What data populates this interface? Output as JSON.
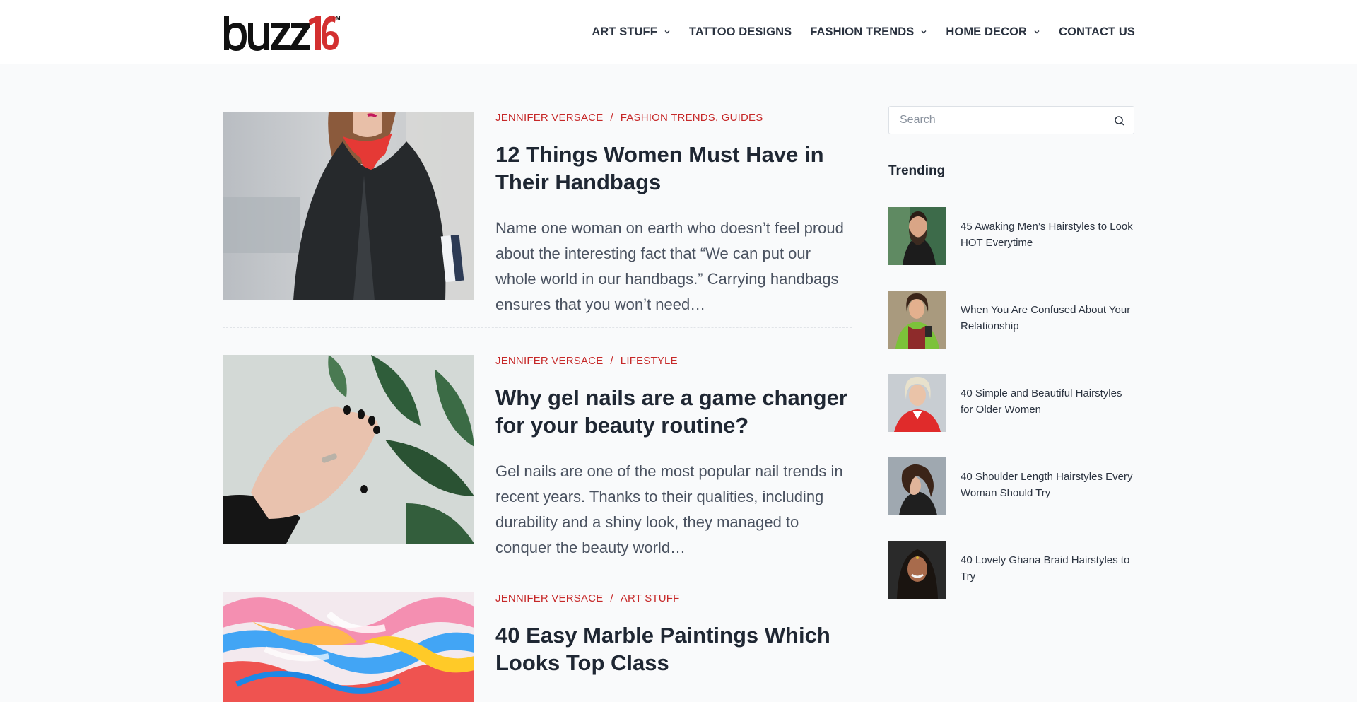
{
  "header": {
    "logo_text": "buzz16",
    "logo_tm": "TM",
    "nav": [
      {
        "label": "ART STUFF",
        "has_dropdown": true
      },
      {
        "label": "TATTOO DESIGNS",
        "has_dropdown": false
      },
      {
        "label": "FASHION TRENDS",
        "has_dropdown": true
      },
      {
        "label": "HOME DECOR",
        "has_dropdown": true
      },
      {
        "label": "CONTACT US",
        "has_dropdown": false
      }
    ]
  },
  "posts": [
    {
      "author": "JENNIFER VERSACE",
      "separator": "/",
      "categories": "FASHION TRENDS, GUIDES",
      "title": "12 Things Women Must Have in Their Handbags",
      "excerpt": "Name one woman on earth who doesn’t feel proud about the interesting fact that “We can put our whole world in our handbags.” Carrying handbags ensures that you won’t need…",
      "image_icon": "woman-blazer-red-scarf-image"
    },
    {
      "author": "JENNIFER VERSACE",
      "separator": "/",
      "categories": "LIFESTYLE",
      "title": "Why gel nails are a game changer for your beauty routine?",
      "excerpt": "Gel nails are one of the most popular nail trends in recent years. Thanks to their qualities, including durability and a shiny look, they managed to conquer the beauty world…",
      "image_icon": "hand-black-nails-leaves-image"
    },
    {
      "author": "JENNIFER VERSACE",
      "separator": "/",
      "categories": "ART STUFF",
      "title": "40 Easy Marble Paintings Which Looks Top Class",
      "excerpt": "",
      "image_icon": "marble-paint-image"
    }
  ],
  "sidebar": {
    "search_placeholder": "Search",
    "trending_title": "Trending",
    "trending": [
      {
        "title": "45 Awaking Men’s Hairstyles to Look HOT Everytime",
        "thumb_icon": "bearded-man-thumbnail"
      },
      {
        "title": "When You Are Confused About Your Relationship",
        "thumb_icon": "woman-green-jacket-thumbnail"
      },
      {
        "title": "40 Simple and Beautiful Hairstyles for Older Women",
        "thumb_icon": "blonde-woman-red-jacket-thumbnail"
      },
      {
        "title": "40 Shoulder Length Hairstyles Every Woman Should Try",
        "thumb_icon": "woman-wavy-hair-thumbnail"
      },
      {
        "title": "40 Lovely Ghana Braid Hairstyles to Try",
        "thumb_icon": "woman-braids-thumbnail"
      }
    ]
  },
  "colors": {
    "accent_red": "#c62828",
    "text_dark": "#1f2733",
    "background": "#f9fafb"
  }
}
